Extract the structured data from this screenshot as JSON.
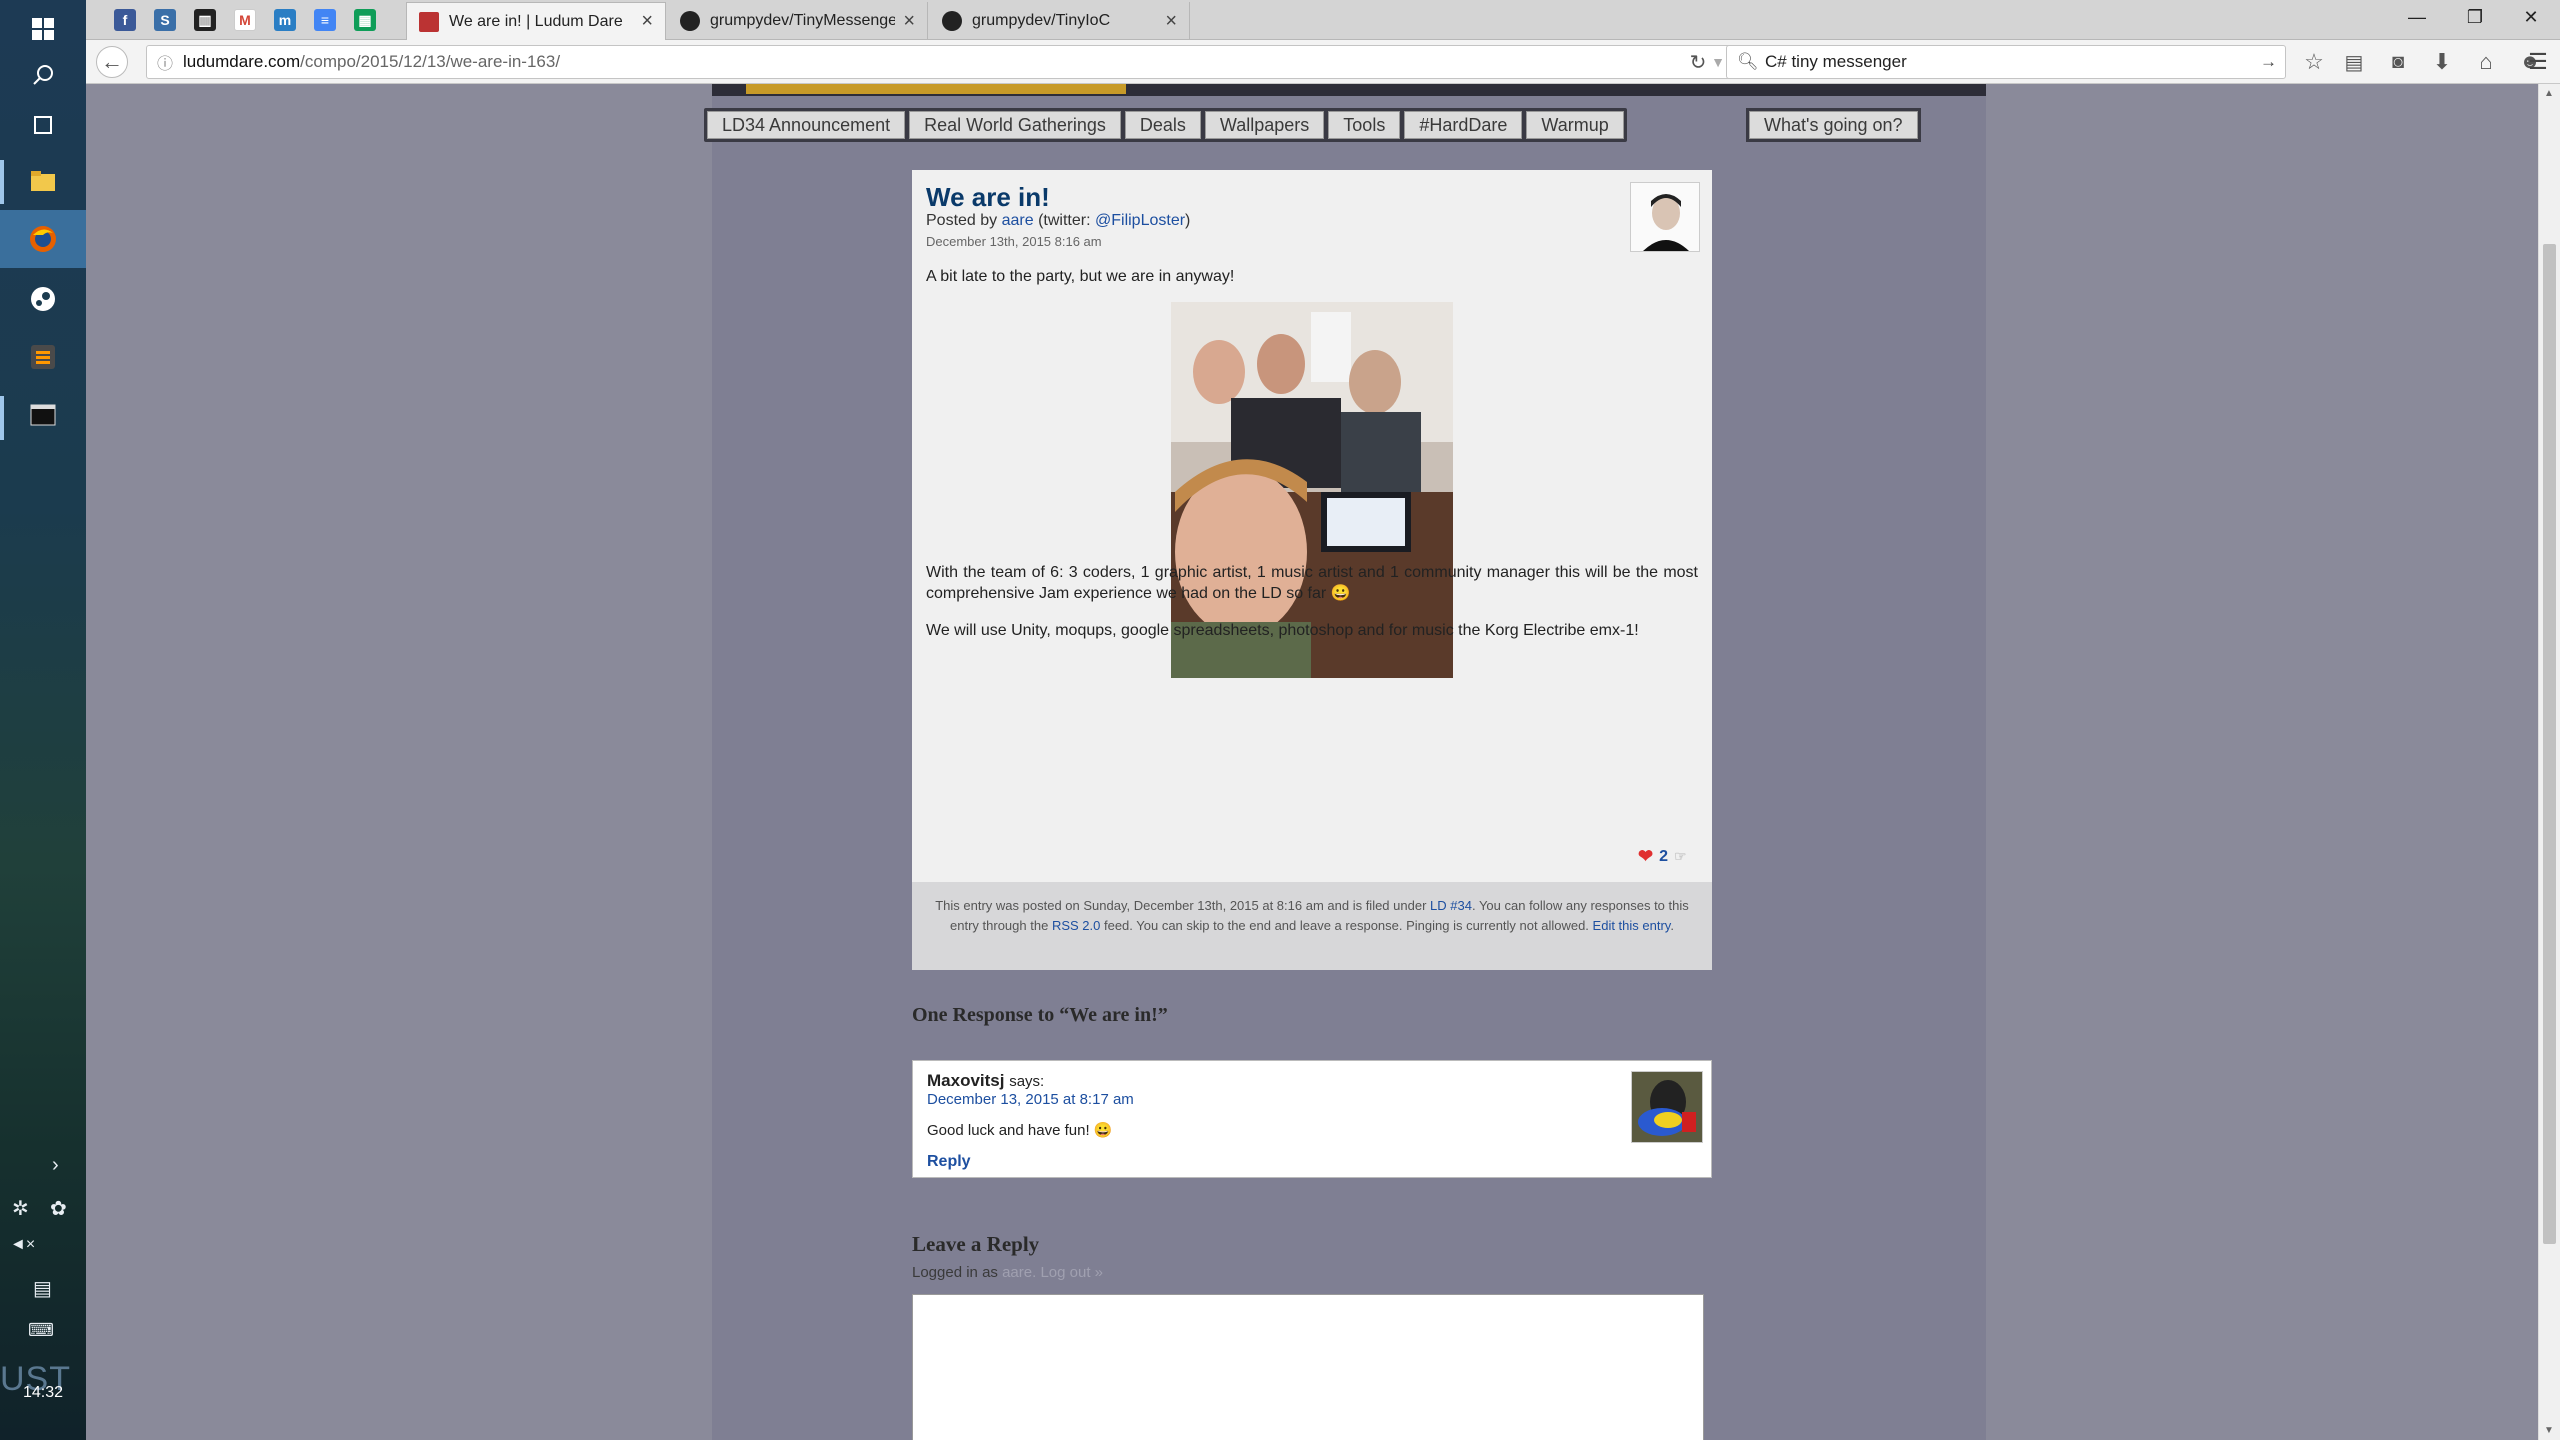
{
  "taskbar": {
    "clock": "14:32",
    "watermark": "UST",
    "icons": [
      "windows-start-icon",
      "search-icon",
      "task-view-icon",
      "file-explorer-icon",
      "firefox-icon",
      "steam-icon",
      "sublime-text-icon",
      "terminal-icon"
    ]
  },
  "browser": {
    "tabs": [
      {
        "title": "We are in! | Ludum Dare"
      },
      {
        "title": "grumpydev/TinyMessenger"
      },
      {
        "title": "grumpydev/TinyIoC"
      }
    ],
    "url_host": "ludumdare.com",
    "url_path": "/compo/2015/12/13/we-are-in-163/",
    "search_value": "C# tiny messenger"
  },
  "site_nav": {
    "items": [
      "LD34 Announcement",
      "Real World Gatherings",
      "Deals",
      "Wallpapers",
      "Tools",
      "#HardDare",
      "Warmup"
    ],
    "whats_going_on": "What's going on?"
  },
  "post": {
    "title": "We are in!",
    "posted_by_prefix": "Posted by",
    "author": "aare",
    "twitter_prefix": "(twitter:",
    "twitter_handle": "@FilipLoster",
    "twitter_suffix": ")",
    "date": "December 13th, 2015 8:16 am",
    "intro": "A bit late to the party, but we are in anyway!",
    "paragraph1": "With the team of 6: 3 coders, 1 graphic artist, 1 music artist and 1 community manager this will be the most comprehensive Jam experience we had on the LD so far 😀",
    "paragraph2": "We will use Unity, moqups, google spreadsheets, photoshop and for music the Korg Electribe emx-1!",
    "likes": "2",
    "footer": {
      "part1": "This entry was posted on Sunday, December 13th, 2015 at 8:16 am and is filed under",
      "category": "LD #34",
      "part2": ". You can follow any responses to this entry through the",
      "rss": "RSS 2.0",
      "part3": "feed. You can skip to the end and leave a response. Pinging is currently not allowed.",
      "edit": "Edit this entry"
    }
  },
  "comments": {
    "title": "One Response to “We are in!”",
    "items": [
      {
        "author": "Maxovitsj",
        "says": "says:",
        "date": "December 13, 2015 at 8:17 am",
        "text": "Good luck and have fun! 😀",
        "reply": "Reply"
      }
    ]
  },
  "reply_form": {
    "title": "Leave a Reply",
    "logged_in_prefix": "Logged in as",
    "user": "aare",
    "logout": "Log out »"
  }
}
